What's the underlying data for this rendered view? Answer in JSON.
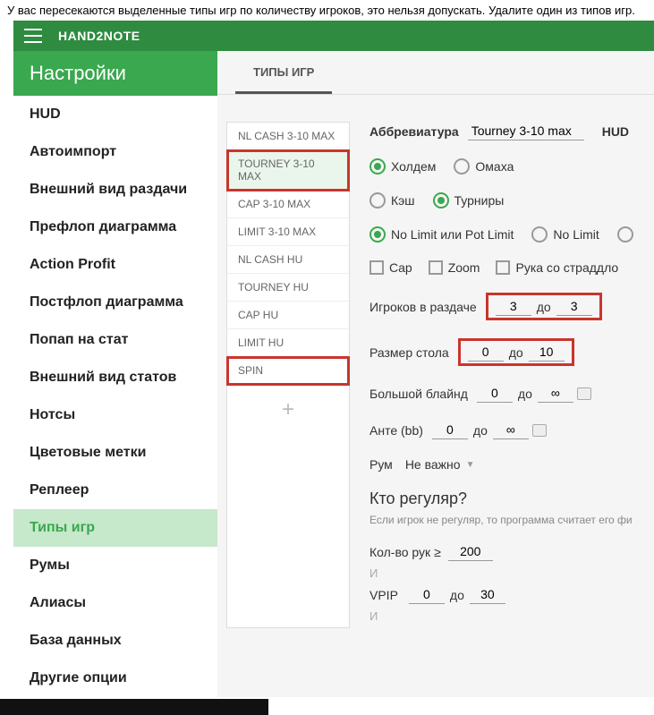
{
  "instruction": "У вас пересекаются выделенные типы игр по количеству игроков, это нельзя допускать.  Удалите один из типов игр.",
  "app_title": "HAND2NOTE",
  "sidebar_header": "Настройки",
  "sidebar": {
    "items": [
      {
        "label": "HUD"
      },
      {
        "label": "Автоимпорт"
      },
      {
        "label": "Внешний вид раздачи"
      },
      {
        "label": "Префлоп диаграмма"
      },
      {
        "label": "Action Profit"
      },
      {
        "label": "Постфлоп диаграмма"
      },
      {
        "label": "Попап на стат"
      },
      {
        "label": "Внешний вид статов"
      },
      {
        "label": "Нотсы"
      },
      {
        "label": "Цветовые метки"
      },
      {
        "label": "Реплеер"
      },
      {
        "label": "Типы игр"
      },
      {
        "label": "Румы"
      },
      {
        "label": "Алиасы"
      },
      {
        "label": "База данных"
      },
      {
        "label": "Другие опции"
      }
    ]
  },
  "tabs": {
    "active": "ТИПЫ ИГР"
  },
  "game_types": [
    {
      "label": "NL CASH 3-10 MAX"
    },
    {
      "label": "TOURNEY 3-10 MAX"
    },
    {
      "label": "CAP 3-10 MAX"
    },
    {
      "label": "LIMIT 3-10 MAX"
    },
    {
      "label": "NL CASH HU"
    },
    {
      "label": "TOURNEY HU"
    },
    {
      "label": "CAP HU"
    },
    {
      "label": "LIMIT HU"
    },
    {
      "label": "SPIN"
    }
  ],
  "details": {
    "abbr_label": "Аббревиатура",
    "abbr_value": "Tourney 3-10 max",
    "hud_label": "HUD",
    "game1": {
      "holdem": "Холдем",
      "omaha": "Омаха"
    },
    "game2": {
      "cash": "Кэш",
      "tourney": "Турниры"
    },
    "limit": {
      "nl_pl": "No Limit или Pot Limit",
      "nl": "No Limit"
    },
    "chk": {
      "cap": "Cap",
      "zoom": "Zoom",
      "straddle": "Рука со страддло"
    },
    "players_label": "Игроков в раздаче",
    "players_from": "3",
    "players_to": "3",
    "table_label": "Размер стола",
    "table_from": "0",
    "table_to": "10",
    "bb_label": "Большой блайнд",
    "bb_from": "0",
    "bb_to": "∞",
    "ante_label": "Анте (bb)",
    "ante_from": "0",
    "ante_to": "∞",
    "room_label": "Рум",
    "room_value": "Не важно",
    "sep": "до",
    "reg_title": "Кто регуляр?",
    "reg_sub": "Если игрок не регуляр, то программа считает его фи",
    "hands_label": "Кол-во рук ≥",
    "hands_value": "200",
    "and": "И",
    "vpip_label": "VPIP",
    "vpip_from": "0",
    "vpip_to": "30"
  }
}
